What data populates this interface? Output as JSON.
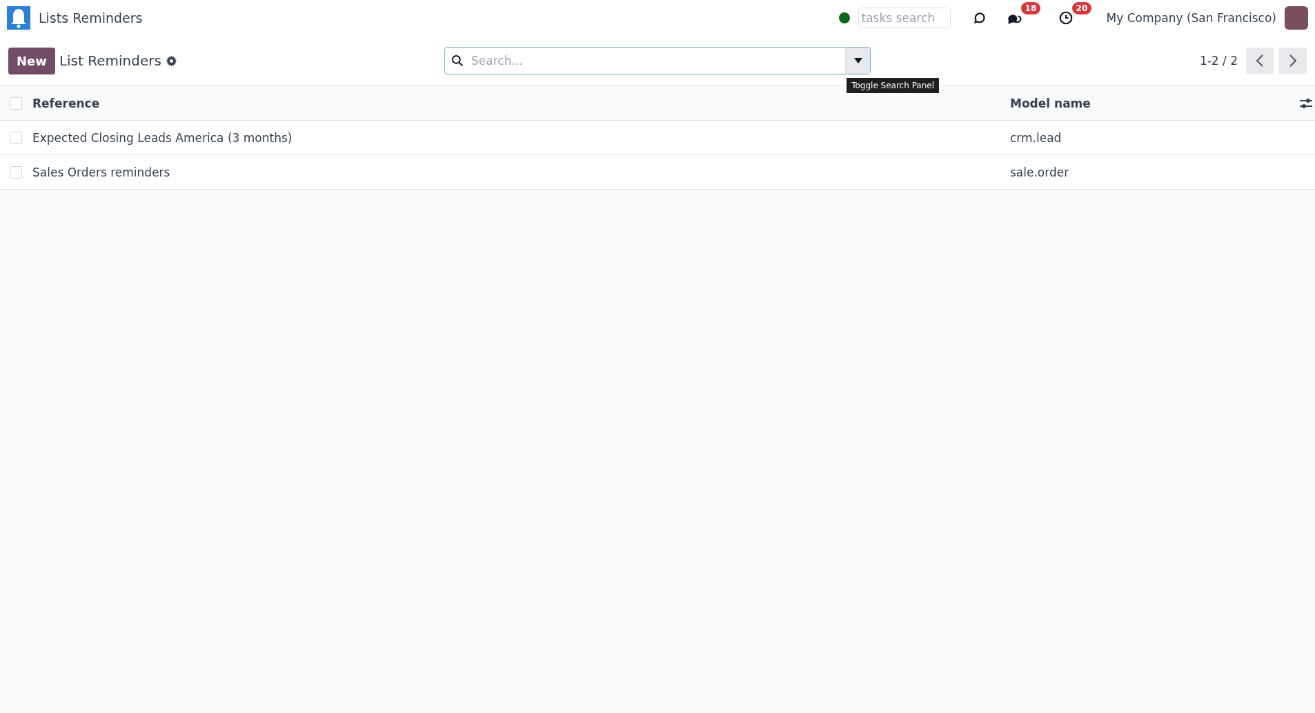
{
  "navbar": {
    "app_title": "Lists Reminders",
    "status_online": true,
    "tasks_search": {
      "placeholder": "tasks search"
    },
    "messages_badge": "18",
    "activities_badge": "20",
    "company": "My Company (San Francisco)"
  },
  "control_panel": {
    "new_button": "New",
    "breadcrumb": "List Reminders",
    "search": {
      "placeholder": "Search..."
    },
    "tooltip": "Toggle Search Panel",
    "pager": "1-2 / 2"
  },
  "table": {
    "columns": [
      {
        "label": "Reference"
      },
      {
        "label": "Model name"
      }
    ],
    "select_all_checked": false,
    "rows": [
      {
        "cells": [
          "Expected Closing Leads America (3 months)",
          "crm.lead"
        ],
        "checked": false
      },
      {
        "cells": [
          "Sales Orders reminders",
          "sale.order"
        ],
        "checked": false
      }
    ]
  }
}
